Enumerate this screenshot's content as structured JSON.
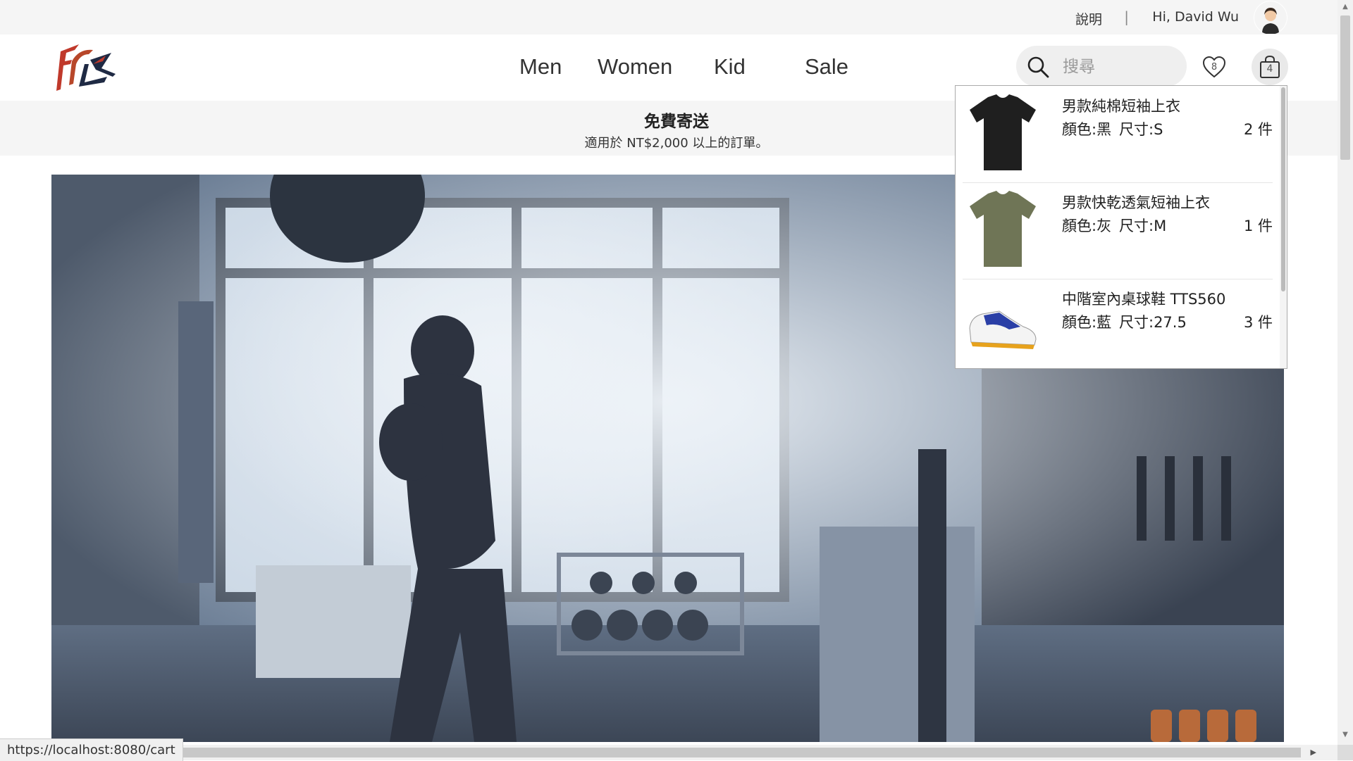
{
  "topbar": {
    "help_label": "說明",
    "divider": "|",
    "greeting": "Hi, David Wu"
  },
  "header": {
    "nav": [
      "Men",
      "Women",
      "Kid",
      "Sale"
    ],
    "search_placeholder": "搜尋",
    "wishlist_count": "8",
    "cart_count": "4"
  },
  "promo": {
    "title": "免費寄送",
    "subtitle": "適用於 NT$2,000 以上的訂單。"
  },
  "cart": {
    "items": [
      {
        "name": "男款純棉短袖上衣",
        "color": "顏色:黑",
        "size": "尺寸:S",
        "qty": "2 件",
        "thumb_color": "#1f1f1f"
      },
      {
        "name": "男款快乾透氣短袖上衣",
        "color": "顏色:灰",
        "size": "尺寸:M",
        "qty": "1 件",
        "thumb_color": "#6f7556"
      },
      {
        "name": "中階室內桌球鞋 TTS560",
        "color": "顏色:藍",
        "size": "尺寸:27.5",
        "qty": "3 件",
        "thumb_color": "#2a3fa6"
      }
    ]
  },
  "status_url": "https://localhost:8080/cart",
  "colors": {
    "logo_red": "#c0392b",
    "logo_navy": "#1f2a44",
    "topbar_bg": "#f5f5f5"
  }
}
